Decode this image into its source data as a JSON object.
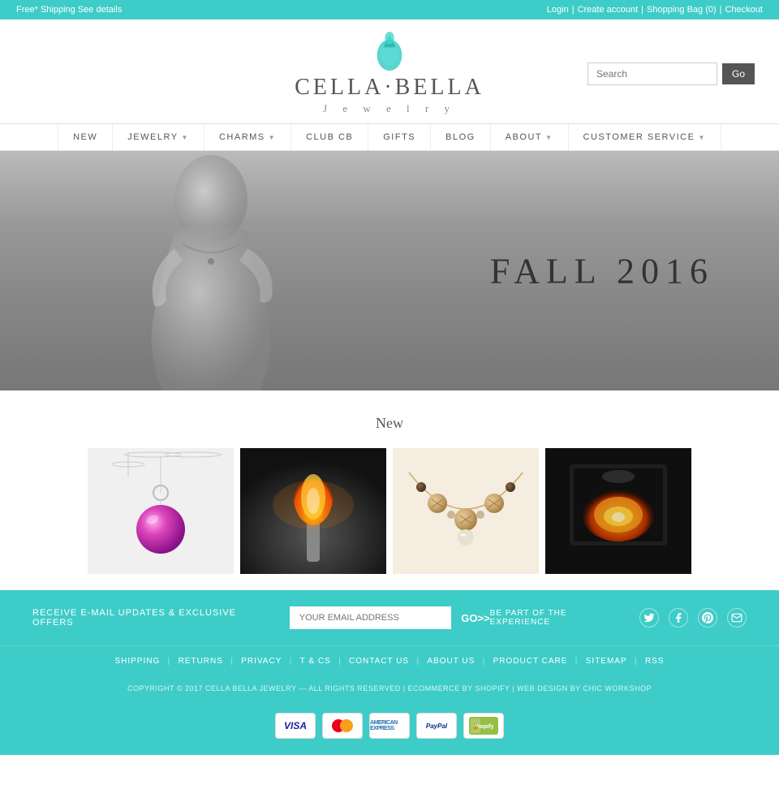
{
  "topbar": {
    "left": "Free* Shipping See details",
    "right": {
      "login": "Login",
      "create": "Create account",
      "bag": "Shopping Bag (0)",
      "checkout": "Checkout"
    }
  },
  "header": {
    "logo_brand": "CELLA·BELLA",
    "logo_sub": "J e w e l r y",
    "search_placeholder": "Search",
    "search_btn": "Go"
  },
  "nav": {
    "items": [
      {
        "label": "NEW",
        "has_arrow": false
      },
      {
        "label": "JEWELRY",
        "has_arrow": true
      },
      {
        "label": "CHARMS",
        "has_arrow": true
      },
      {
        "label": "CLUB CB",
        "has_arrow": false
      },
      {
        "label": "GIFTS",
        "has_arrow": false
      },
      {
        "label": "BLOG",
        "has_arrow": false
      },
      {
        "label": "ABOUT",
        "has_arrow": true
      },
      {
        "label": "CUSTOMER SERVICE",
        "has_arrow": true
      }
    ]
  },
  "hero": {
    "text": "FALL 2016"
  },
  "new_section": {
    "title": "New",
    "products": [
      {
        "id": 1,
        "type": "pendant"
      },
      {
        "id": 2,
        "type": "torch"
      },
      {
        "id": 3,
        "type": "necklace"
      },
      {
        "id": 4,
        "type": "furnace"
      }
    ]
  },
  "footer": {
    "email_label": "RECEIVE E-MAIL UPDATES & EXCLUSIVE OFFERS",
    "email_placeholder": "YOUR EMAIL ADDRESS",
    "go_btn": "GO>>",
    "social_label": "BE PART OF THE EXPERIENCE",
    "social": [
      "twitter",
      "facebook",
      "pinterest",
      "email"
    ],
    "links": [
      "SHIPPING",
      "RETURNS",
      "PRIVACY",
      "T & CS",
      "CONTACT US",
      "ABOUT US",
      "PRODUCT CARE",
      "SITEMAP",
      "RSS"
    ],
    "copyright": "COPYRIGHT © 2017 CELLA BELLA JEWELRY — ALL RIGHTS RESERVED | ECOMMERCE BY SHOPIFY | WEB DESIGN BY CHIC WORKSHOP",
    "payment": [
      "VISA",
      "MC",
      "AMEX",
      "PAYPAL",
      "SHOPIFY"
    ]
  },
  "colors": {
    "teal": "#3eccc8",
    "dark": "#555",
    "light_gray": "#f5f5f5"
  }
}
